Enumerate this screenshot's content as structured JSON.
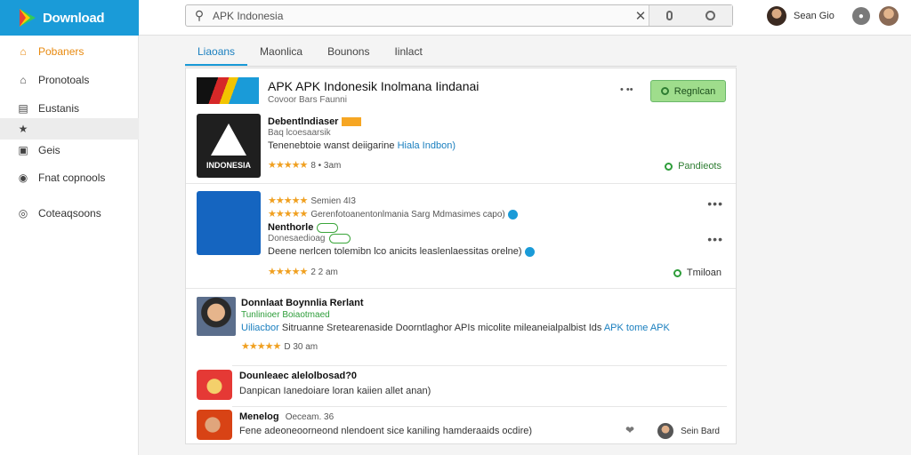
{
  "brand": {
    "name": "Download"
  },
  "search": {
    "value": "APK Indonesia",
    "placeholder": "APK Indonesia"
  },
  "user": {
    "name": "Sean Gio"
  },
  "sidebar": {
    "items": [
      {
        "label": "Pobaners"
      },
      {
        "label": "Pronotoals"
      },
      {
        "label": "Eustanis"
      },
      {
        "label": ""
      },
      {
        "label": "Geis"
      },
      {
        "label": "Fnat copnools"
      },
      {
        "label": "Coteaqsoons"
      }
    ]
  },
  "tabs": [
    {
      "label": "Liaoans"
    },
    {
      "label": "Maonlica"
    },
    {
      "label": "Bounons"
    },
    {
      "label": "Iinlact"
    }
  ],
  "banner": {
    "title": "APK APK Indonesik Inolmana Iindanai",
    "subtitle": "Covoor Bars Faunni",
    "dots": "• ••",
    "register_label": "Regnlcan"
  },
  "apps": [
    {
      "title": "Debentlndiaser",
      "subtitle": "Baq lcoesaarsik",
      "description": "Tenenebtoie wanst deiigarine",
      "description_link": "Hiala Indbon)",
      "stars": "★★★★★",
      "meta": "8 • 3am",
      "thumb_word": "INDONESIA",
      "action_label": "Pandieots"
    },
    {
      "rating_line_1": "Semien 4I3",
      "rating_line_2": "Gerenfotoanentonlmania Sarg Mdmasimes capo)",
      "title": "Nenthorle",
      "subtitle": "Donesaedioag",
      "description": "Deene nerlcen tolemibn lco anicits leaslenlaessitas orelne)",
      "stars_1": "★★★★★",
      "stars_2": "★★★★★",
      "stars_3": "★★★★★",
      "meta": "2 2 am",
      "action_label": "Tmiloan",
      "more": "•••"
    }
  ],
  "featured": {
    "title": "Donnlaat Boynnlia Rerlant",
    "subtitle": "Tunlinioer Boiaotmaed",
    "description": "Sitruanne Sretearenaside Doorntlaghor APIs micolite mileaneialpalbist Ids",
    "description_link": "APK tome APK",
    "description_prefix": "Uiliacbor",
    "stars": "★★★★★",
    "meta": "D 30 am"
  },
  "list": [
    {
      "title": "Dounleaec alelolbosad?0",
      "description": "Danpican Ianedoiare loran kaiien allet anan)"
    },
    {
      "title": "Menelog",
      "title_meta": "Oeceam. 36",
      "description": "Fene adeoneoorneond nlendoent sice kaniling hamderaaids ocdire)",
      "user_name": "Sein Bard"
    }
  ]
}
